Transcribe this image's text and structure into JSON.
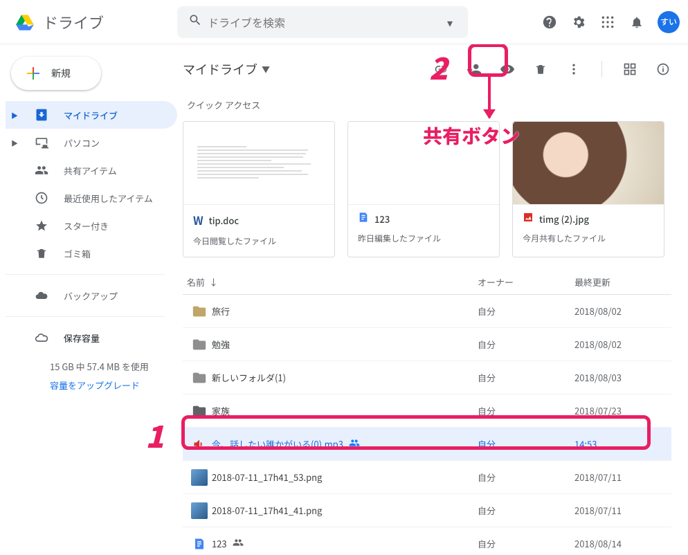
{
  "header": {
    "app_title": "ドライブ",
    "search_placeholder": "ドライブを検索",
    "avatar_text": "すい"
  },
  "sidebar": {
    "new_label": "新規",
    "items": [
      {
        "label": "マイドライブ",
        "icon": "drive",
        "active": true,
        "expandable": true
      },
      {
        "label": "パソコン",
        "icon": "devices",
        "expandable": true
      },
      {
        "label": "共有アイテム",
        "icon": "people"
      },
      {
        "label": "最近使用したアイテム",
        "icon": "clock"
      },
      {
        "label": "スター付き",
        "icon": "star"
      },
      {
        "label": "ゴミ箱",
        "icon": "trash"
      }
    ],
    "backup_label": "バックアップ",
    "storage_label": "保存容量",
    "storage_usage": "15 GB 中 57.4 MB を使用",
    "upgrade_label": "容量をアップグレード"
  },
  "content": {
    "breadcrumb": "マイドライブ",
    "quick_label": "クイック アクセス",
    "columns": {
      "name": "名前",
      "owner": "オーナー",
      "date": "最終更新"
    },
    "quick": [
      {
        "name": "tip.doc",
        "meta": "今日閲覧したファイル",
        "icon": "word",
        "prev": "doc"
      },
      {
        "name": "123",
        "meta": "昨日編集したファイル",
        "icon": "docs",
        "prev": "blank"
      },
      {
        "name": "timg (2).jpg",
        "meta": "今月共有したファイル",
        "icon": "image",
        "prev": "photo"
      }
    ],
    "files": [
      {
        "icon": "folder-brown",
        "name": "旅行",
        "owner": "自分",
        "date": "2018/08/02"
      },
      {
        "icon": "folder-grey",
        "name": "勉強",
        "owner": "自分",
        "date": "2018/08/02"
      },
      {
        "icon": "folder-grey",
        "name": "新しいフォルダ(1)",
        "owner": "自分",
        "date": "2018/08/03"
      },
      {
        "icon": "folder-dark",
        "name": "家族",
        "owner": "自分",
        "date": "2018/07/23"
      },
      {
        "icon": "audio",
        "name": "今、話したい誰かがいる(0).mp3",
        "owner": "自分",
        "date": "14:53",
        "shared": true,
        "selected": true
      },
      {
        "icon": "thumb",
        "name": "2018-07-11_17h41_53.png",
        "owner": "自分",
        "date": "2018/07/11"
      },
      {
        "icon": "thumb",
        "name": "2018-07-11_17h41_41.png",
        "owner": "自分",
        "date": "2018/07/11"
      },
      {
        "icon": "docs",
        "name": "123",
        "owner": "自分",
        "date": "2018/08/14",
        "shared": true
      }
    ]
  },
  "annotations": {
    "step1": "1",
    "step2": "2",
    "share_label": "共有ボタン"
  }
}
